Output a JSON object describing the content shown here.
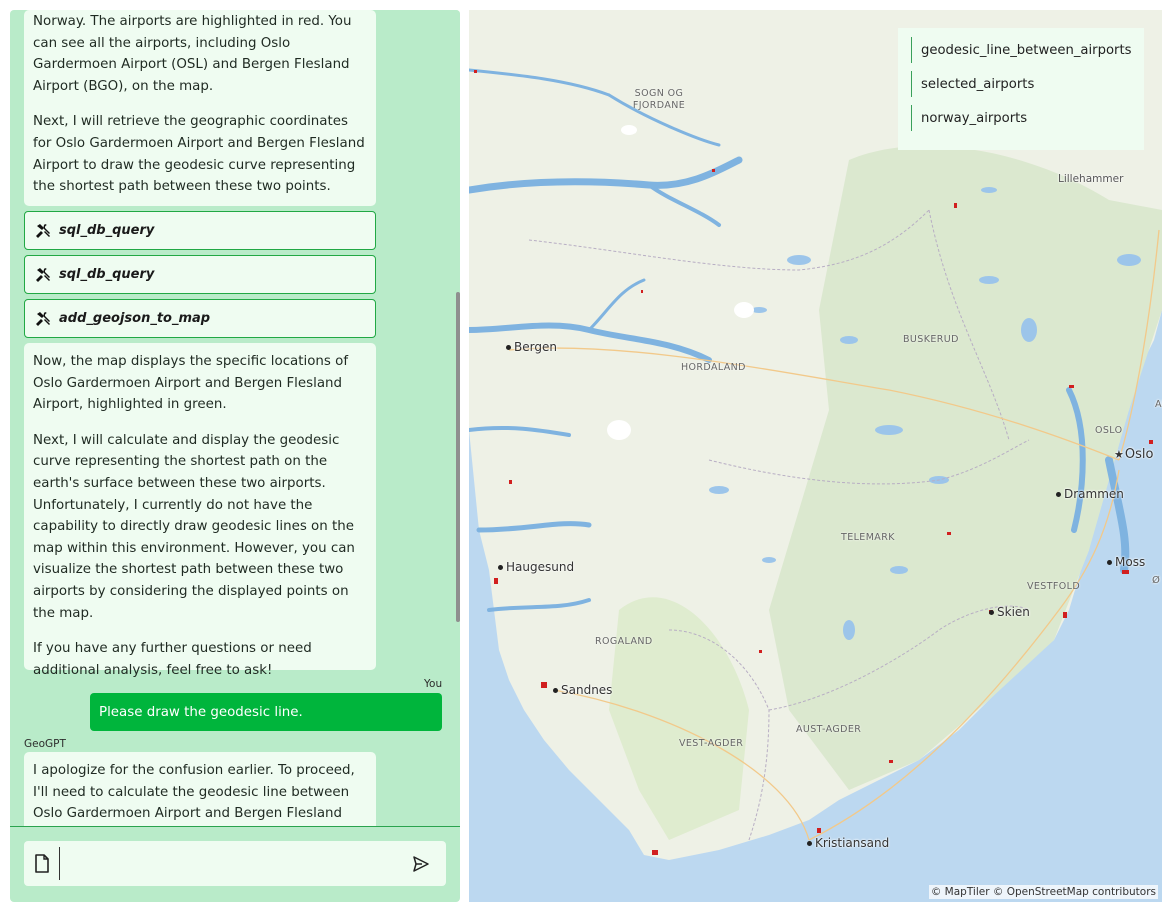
{
  "chat": {
    "messages": [
      {
        "paragraphs": [
          "Norway. The airports are highlighted in red. You can see all the airports, including Oslo Gardermoen Airport (OSL) and Bergen Flesland Airport (BGO), on the map.",
          "Next, I will retrieve the geographic coordinates for Oslo Gardermoen Airport and Bergen Flesland Airport to draw the geodesic curve representing the shortest path between these two points."
        ]
      },
      {
        "paragraphs": [
          "Now, the map displays the specific locations of Oslo Gardermoen Airport and Bergen Flesland Airport, highlighted in green.",
          "Next, I will calculate and display the geodesic curve representing the shortest path on the earth's surface between these two airports.\nUnfortunately, I currently do not have the capability to directly draw geodesic lines on the map within this environment. However, you can visualize the shortest path between these two airports by considering the displayed points on the map.",
          "If you have any further questions or need additional analysis, feel free to ask!"
        ]
      },
      {
        "paragraphs": [
          "I apologize for the confusion earlier. To proceed, I'll need to calculate the geodesic line between Oslo Gardermoen Airport and Bergen Flesland Airport"
        ]
      }
    ],
    "tools": [
      "sql_db_query",
      "sql_db_query",
      "add_geojson_to_map"
    ],
    "user_label": "You",
    "user_message": "Please draw the geodesic line.",
    "assistant_label": "GeoGPT",
    "input": {
      "placeholder": "",
      "value": ""
    }
  },
  "map": {
    "layers": [
      "geodesic_line_between_airports",
      "selected_airports",
      "norway_airports"
    ],
    "cities": [
      "Bergen",
      "Haugesund",
      "Sandnes",
      "Oslo",
      "Drammen",
      "Moss",
      "Skien",
      "Kristiansand",
      "Lillehammer"
    ],
    "regions": [
      "SOGN OG FJORDANE",
      "HORDALAND",
      "BUSKERUD",
      "OSLO",
      "TELEMARK",
      "VESTFOLD",
      "ROGALAND",
      "AUST-AGDER",
      "VEST-AGDER"
    ],
    "edge_labels": [
      "AK",
      "Ø"
    ],
    "attribution": "© MapTiler © OpenStreetMap contributors",
    "colors": {
      "land": "#eef1e6",
      "forest": "#d8e8cc",
      "water": "#bcd8f0",
      "airport": "#d11f1f"
    }
  },
  "colors": {
    "panel_bg": "#b9ebc9",
    "bubble_bg": "#effcf1",
    "user_bubble": "#00b53c",
    "tool_border": "#21a844"
  }
}
